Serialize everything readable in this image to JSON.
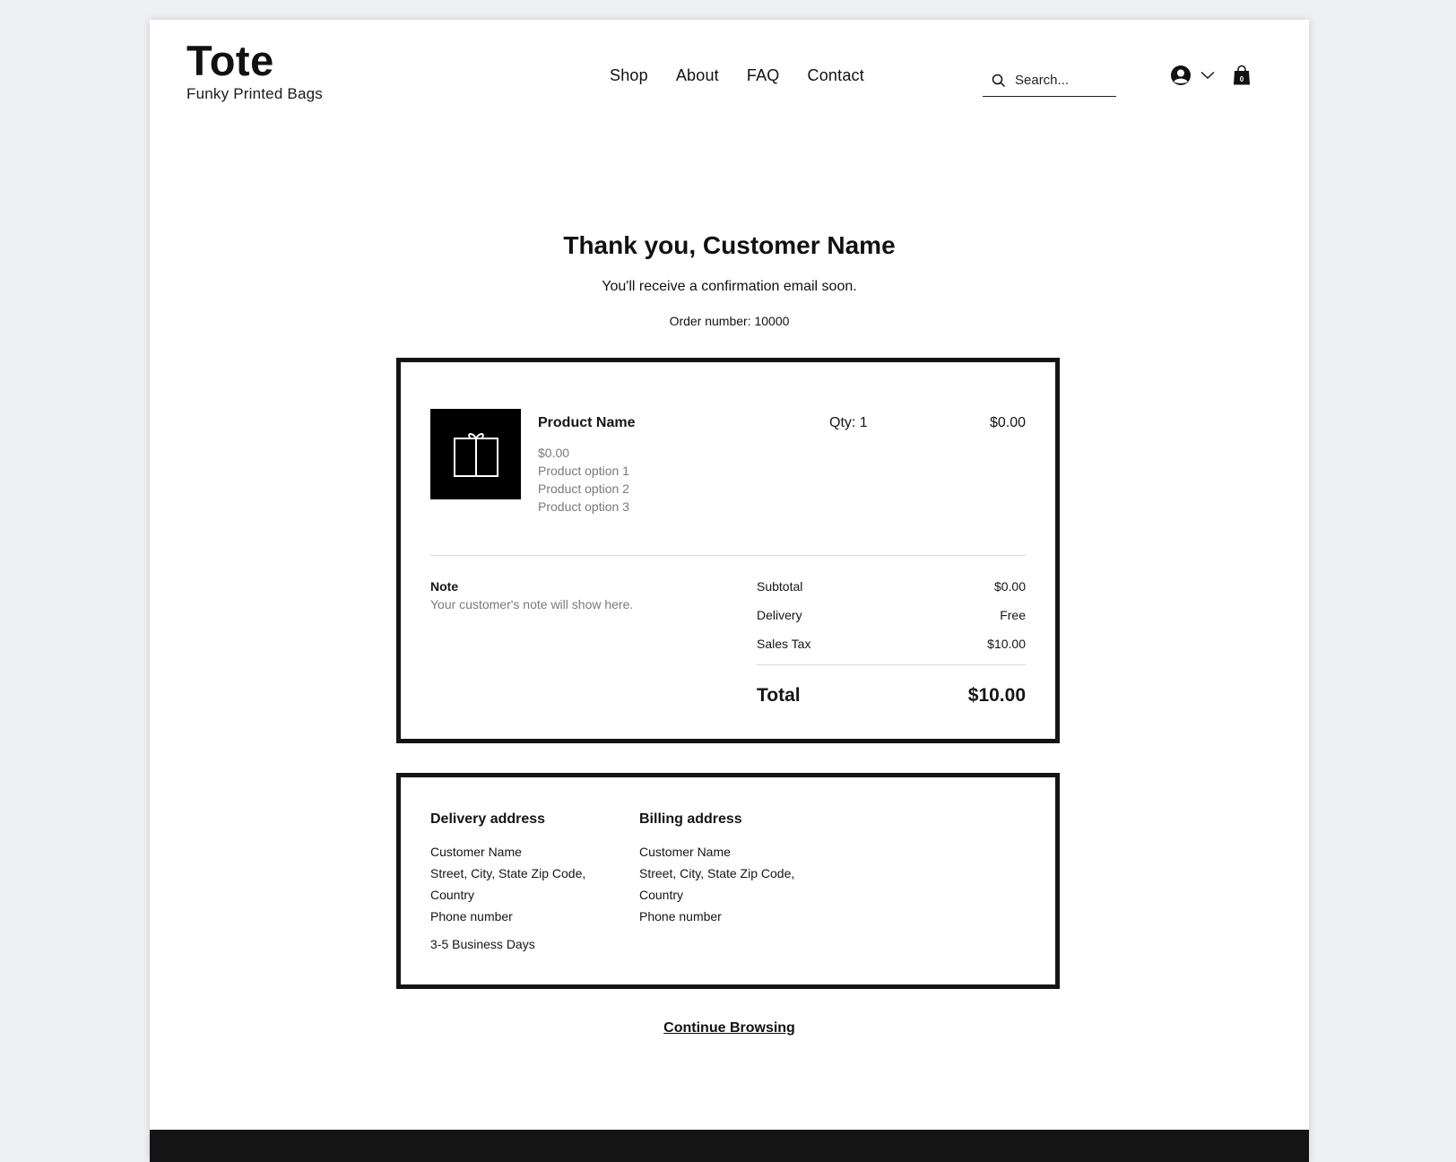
{
  "brand": {
    "title": "Tote",
    "tagline": "Funky Printed Bags"
  },
  "nav": {
    "items": [
      "Shop",
      "About",
      "FAQ",
      "Contact"
    ]
  },
  "search": {
    "placeholder": "Search..."
  },
  "cart": {
    "count": "0"
  },
  "confirmation": {
    "heading": "Thank you, Customer Name",
    "subtext": "You'll receive a confirmation email soon.",
    "order_number": "Order number: 10000"
  },
  "item": {
    "name": "Product Name",
    "unit_price": "$0.00",
    "options": [
      "Product option 1",
      "Product option 2",
      "Product option 3"
    ],
    "qty": "Qty: 1",
    "line_price": "$0.00"
  },
  "note": {
    "label": "Note",
    "text": "Your customer's note will show here."
  },
  "summary": {
    "rows": [
      {
        "label": "Subtotal",
        "value": "$0.00"
      },
      {
        "label": "Delivery",
        "value": "Free"
      },
      {
        "label": "Sales Tax",
        "value": "$10.00"
      }
    ],
    "total_label": "Total",
    "total_value": "$10.00"
  },
  "delivery_address": {
    "title": "Delivery address",
    "lines": [
      "Customer Name",
      "Street, City, State Zip Code,",
      "Country",
      "Phone number"
    ],
    "eta": "3-5 Business Days"
  },
  "billing_address": {
    "title": "Billing address",
    "lines": [
      "Customer Name",
      "Street, City, State Zip Code,",
      "Country",
      "Phone number"
    ]
  },
  "continue_label": "Continue Browsing",
  "colors": {
    "text": "#111111",
    "muted": "#7a7a7a",
    "border": "#141414",
    "background": "#eef0f4"
  }
}
